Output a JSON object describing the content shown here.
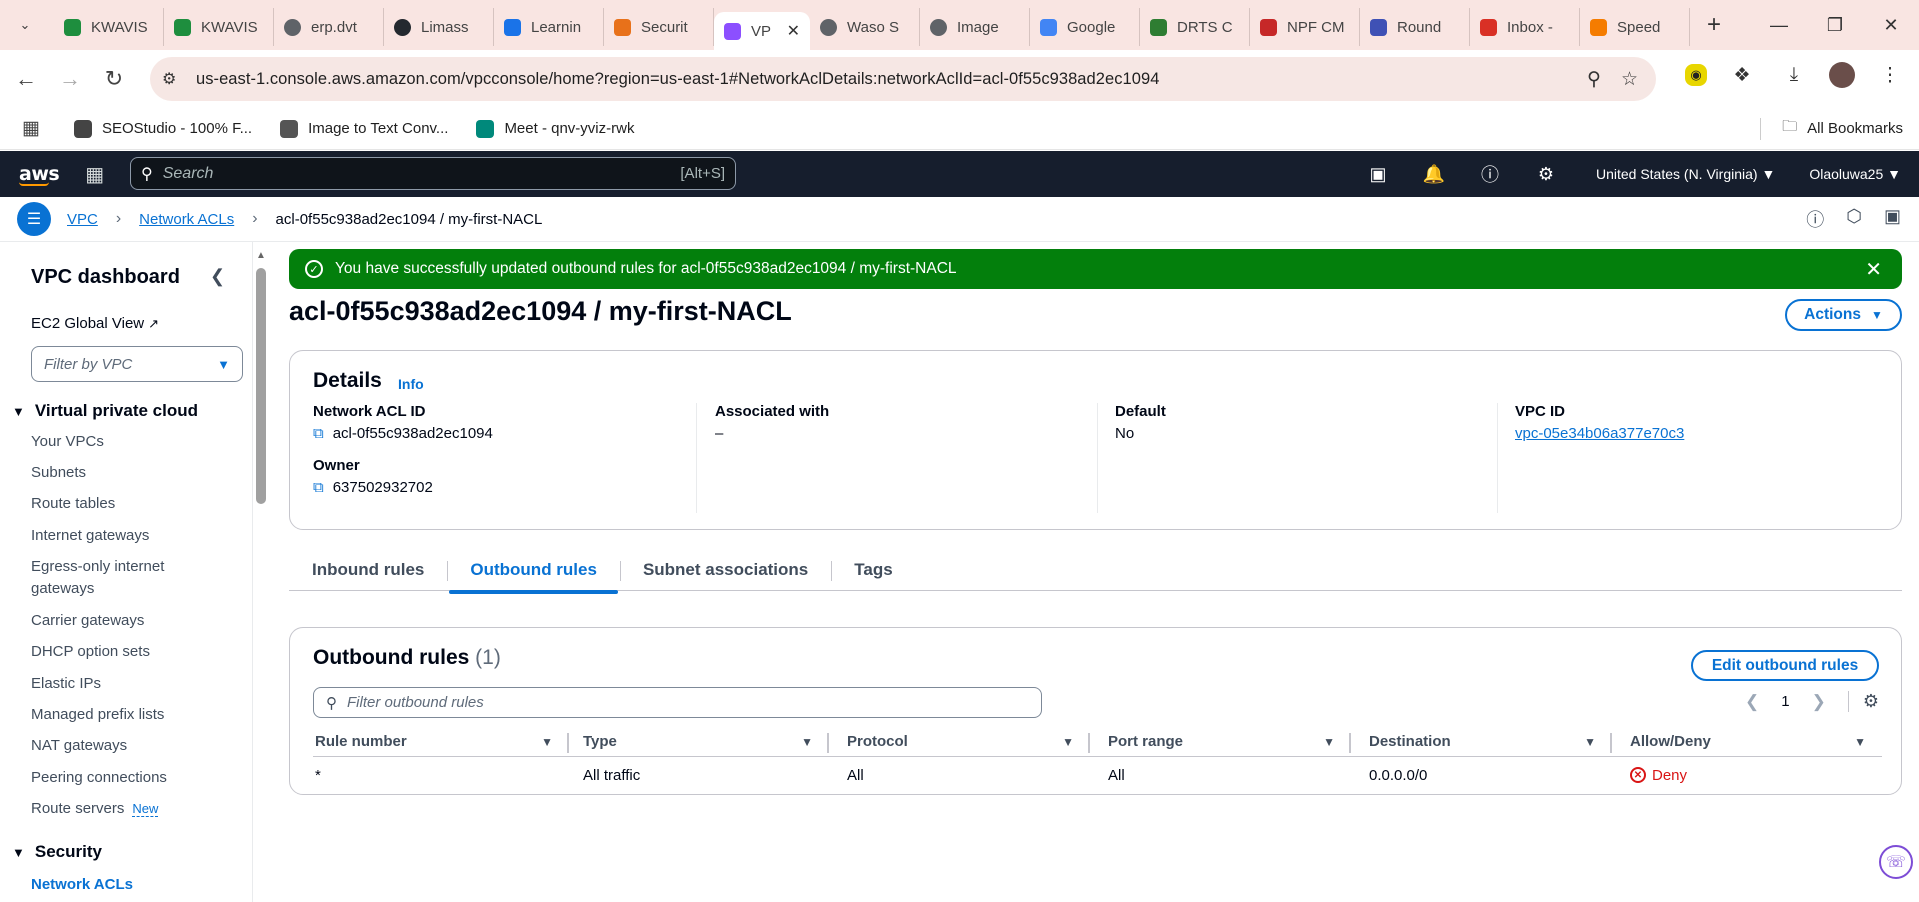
{
  "browser": {
    "tabs": [
      {
        "label": "KWAVIS",
        "color": "#1e8e3e"
      },
      {
        "label": "KWAVIS",
        "color": "#1e8e3e"
      },
      {
        "label": "erp.dvt",
        "color": "#5f6368"
      },
      {
        "label": "Limass",
        "color": "#24292f"
      },
      {
        "label": "Learnin",
        "color": "#1a73e8"
      },
      {
        "label": "Securit",
        "color": "#e8711a"
      },
      {
        "label": "VP",
        "color": "#8c4fff"
      },
      {
        "label": "Waso S",
        "color": "#5f6368"
      },
      {
        "label": "Image",
        "color": "#5f6368"
      },
      {
        "label": "Google",
        "color": "#4285f4"
      },
      {
        "label": "DRTS C",
        "color": "#2e7d32"
      },
      {
        "label": "NPF CM",
        "color": "#c62828"
      },
      {
        "label": "Round",
        "color": "#3f51b5"
      },
      {
        "label": "Inbox -",
        "color": "#d93025"
      },
      {
        "label": "Speed",
        "color": "#f57c00"
      }
    ],
    "url": "us-east-1.console.aws.amazon.com/vpcconsole/home?region=us-east-1#NetworkAclDetails:networkAclId=acl-0f55c938ad2ec1094",
    "bookmarks": [
      {
        "label": "SEOStudio - 100% F...",
        "color": "#444"
      },
      {
        "label": "Image to Text Conv...",
        "color": "#555"
      },
      {
        "label": "Meet - qnv-yviz-rwk",
        "color": "#00897b"
      }
    ],
    "all_bookmarks": "All Bookmarks"
  },
  "aws": {
    "logo": "aws",
    "search_placeholder": "Search",
    "search_shortcut": "[Alt+S]",
    "region": "United States (N. Virginia)",
    "user": "Olaoluwa25"
  },
  "breadcrumb": {
    "root": "VPC",
    "section": "Network ACLs",
    "current": "acl-0f55c938ad2ec1094 / my-first-NACL"
  },
  "sidebar": {
    "title": "VPC dashboard",
    "ec2_global": "EC2 Global View",
    "filter_placeholder": "Filter by VPC",
    "vpc_section": "Virtual private cloud",
    "vpc_items": [
      "Your VPCs",
      "Subnets",
      "Route tables",
      "Internet gateways",
      "Egress-only internet gateways",
      "Carrier gateways",
      "DHCP option sets",
      "Elastic IPs",
      "Managed prefix lists",
      "NAT gateways",
      "Peering connections",
      "Route servers"
    ],
    "new_badge": "New",
    "security_section": "Security",
    "security_items": [
      "Network ACLs"
    ]
  },
  "banner": {
    "message": "You have successfully updated outbound rules for acl-0f55c938ad2ec1094 / my-first-NACL"
  },
  "page": {
    "title": "acl-0f55c938ad2ec1094 / my-first-NACL",
    "actions_label": "Actions"
  },
  "details": {
    "heading": "Details",
    "info": "Info",
    "network_acl_id_label": "Network ACL ID",
    "network_acl_id": "acl-0f55c938ad2ec1094",
    "owner_label": "Owner",
    "owner": "637502932702",
    "associated_label": "Associated with",
    "associated": "–",
    "default_label": "Default",
    "default": "No",
    "vpc_id_label": "VPC ID",
    "vpc_id": "vpc-05e34b06a377e70c3"
  },
  "content_tabs": [
    "Inbound rules",
    "Outbound rules",
    "Subnet associations",
    "Tags"
  ],
  "outbound": {
    "heading": "Outbound rules",
    "count": "(1)",
    "edit_label": "Edit outbound rules",
    "filter_placeholder": "Filter outbound rules",
    "page": "1",
    "columns": [
      "Rule number",
      "Type",
      "Protocol",
      "Port range",
      "Destination",
      "Allow/Deny"
    ],
    "rows": [
      {
        "rule_number": "*",
        "type": "All traffic",
        "protocol": "All",
        "port_range": "All",
        "destination": "0.0.0.0/0",
        "allow_deny": "Deny"
      }
    ]
  }
}
